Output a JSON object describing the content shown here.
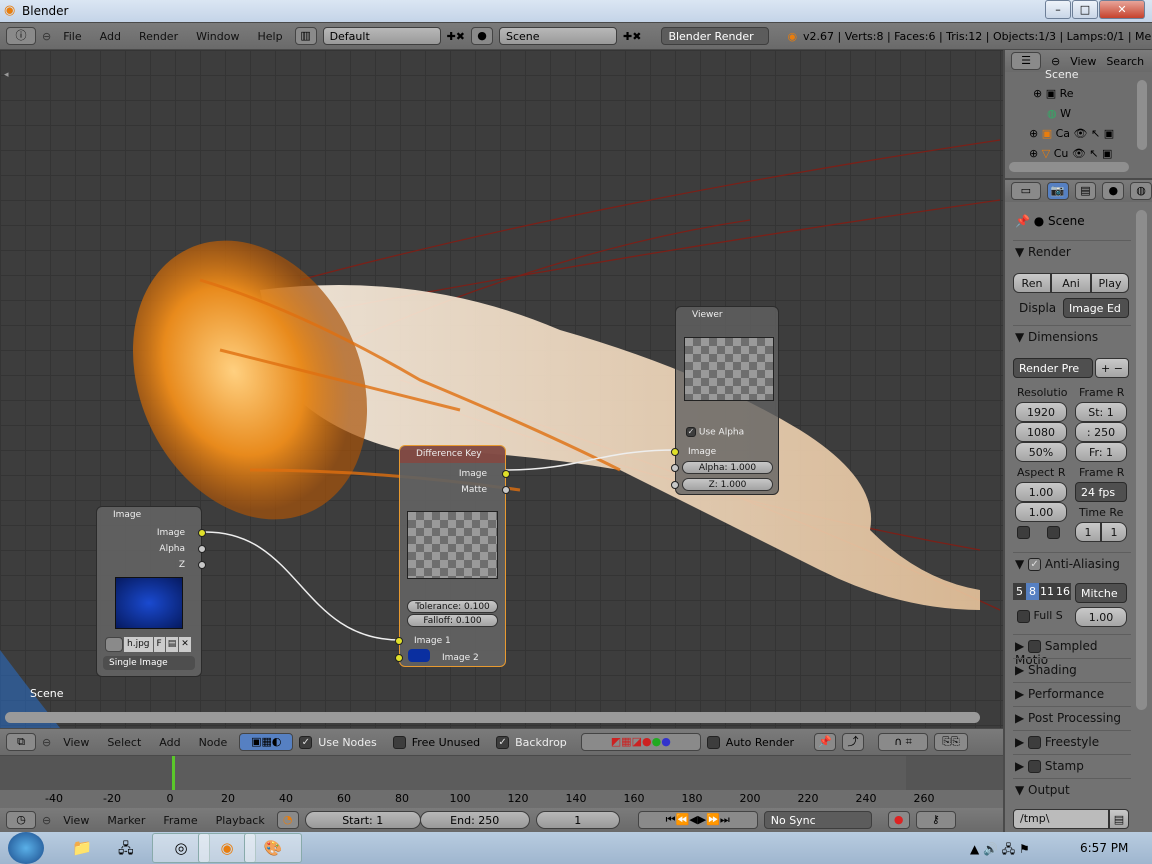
{
  "window": {
    "title": "Blender",
    "controls": [
      "–",
      "□",
      "✕"
    ]
  },
  "top_header": {
    "menus": [
      "File",
      "Add",
      "Render",
      "Window",
      "Help"
    ],
    "screen_layout": "Default",
    "scene": "Scene",
    "render_engine": "Blender Render",
    "stats": "v2.67 | Verts:8 | Faces:6 | Tris:12 | Objects:1/3 | Lamps:0/1 | Me"
  },
  "node_editor": {
    "scene_label": "Scene",
    "image_node": {
      "title": "Image",
      "outputs": [
        "Image",
        "Alpha",
        "Z"
      ],
      "file": "h.jpg",
      "fake_user": "F",
      "source": "Single Image"
    },
    "diff_key_node": {
      "title": "Difference Key",
      "outputs": [
        "Image",
        "Matte"
      ],
      "tolerance": "Tolerance: 0.100",
      "falloff": "Falloff: 0.100",
      "inputs": [
        "Image 1",
        "Image 2"
      ],
      "image2_color": "#0a2fa0"
    },
    "viewer_node": {
      "title": "Viewer",
      "use_alpha": "Use Alpha",
      "use_alpha_checked": true,
      "input": "Image",
      "alpha": "Alpha: 1.000",
      "z": "Z: 1.000"
    }
  },
  "node_header": {
    "menus": [
      "View",
      "Select",
      "Add",
      "Node"
    ],
    "use_nodes": "Use Nodes",
    "use_nodes_checked": true,
    "free_unused": "Free Unused",
    "free_unused_checked": false,
    "backdrop": "Backdrop",
    "backdrop_checked": true,
    "auto_render": "Auto Render",
    "auto_render_checked": false
  },
  "timeline": {
    "ticks": [
      "-40",
      "-20",
      "0",
      "20",
      "40",
      "60",
      "80",
      "100",
      "120",
      "140",
      "160",
      "180",
      "200",
      "220",
      "240",
      "260"
    ],
    "current_frame_marker": 0
  },
  "timeline_header": {
    "menus": [
      "View",
      "Marker",
      "Frame",
      "Playback"
    ],
    "start": "Start: 1",
    "end": "End: 250",
    "current": "1",
    "sync": "No Sync"
  },
  "outliner": {
    "menus": [
      "View",
      "Search"
    ],
    "items": [
      "Scene",
      "Re",
      "W",
      "Ca",
      "Cu"
    ]
  },
  "properties": {
    "context": "Scene",
    "render": {
      "title": "Render",
      "buttons": [
        "Ren",
        "Ani",
        "Play"
      ],
      "display_label": "Displa",
      "display": "Image Ed"
    },
    "dimensions": {
      "title": "Dimensions",
      "preset": "Render Pre",
      "resolution_label": "Resolutio",
      "res_x": "1920",
      "res_y": "1080",
      "res_pct": "50%",
      "frame_range_label": "Frame R",
      "start": "St: 1",
      "end": ": 250",
      "step": "Fr: 1",
      "aspect_label": "Aspect R",
      "aspect_x": "1.00",
      "aspect_y": "1.00",
      "frame_rate_label": "Frame R",
      "fps": "24 fps",
      "time_remap_label": "Time Re",
      "remap_old": "1",
      "remap_new": "1"
    },
    "anti_aliasing": {
      "title": "Anti-Aliasing",
      "checked": true,
      "samples": [
        "5",
        "8",
        "11",
        "16"
      ],
      "selected_sample": "8",
      "filter": "Mitche",
      "full_sample": "Full S",
      "size": "1.00"
    },
    "collapsed": [
      {
        "label": "Sampled Motio",
        "checkbox": true
      },
      {
        "label": "Shading",
        "checkbox": false
      },
      {
        "label": "Performance",
        "checkbox": false
      },
      {
        "label": "Post Processing",
        "checkbox": false
      },
      {
        "label": "Freestyle",
        "checkbox": true
      },
      {
        "label": "Stamp",
        "checkbox": true
      }
    ],
    "output": {
      "title": "Output",
      "path": "/tmp\\"
    }
  },
  "taskbar": {
    "clock": "6:57 PM"
  }
}
